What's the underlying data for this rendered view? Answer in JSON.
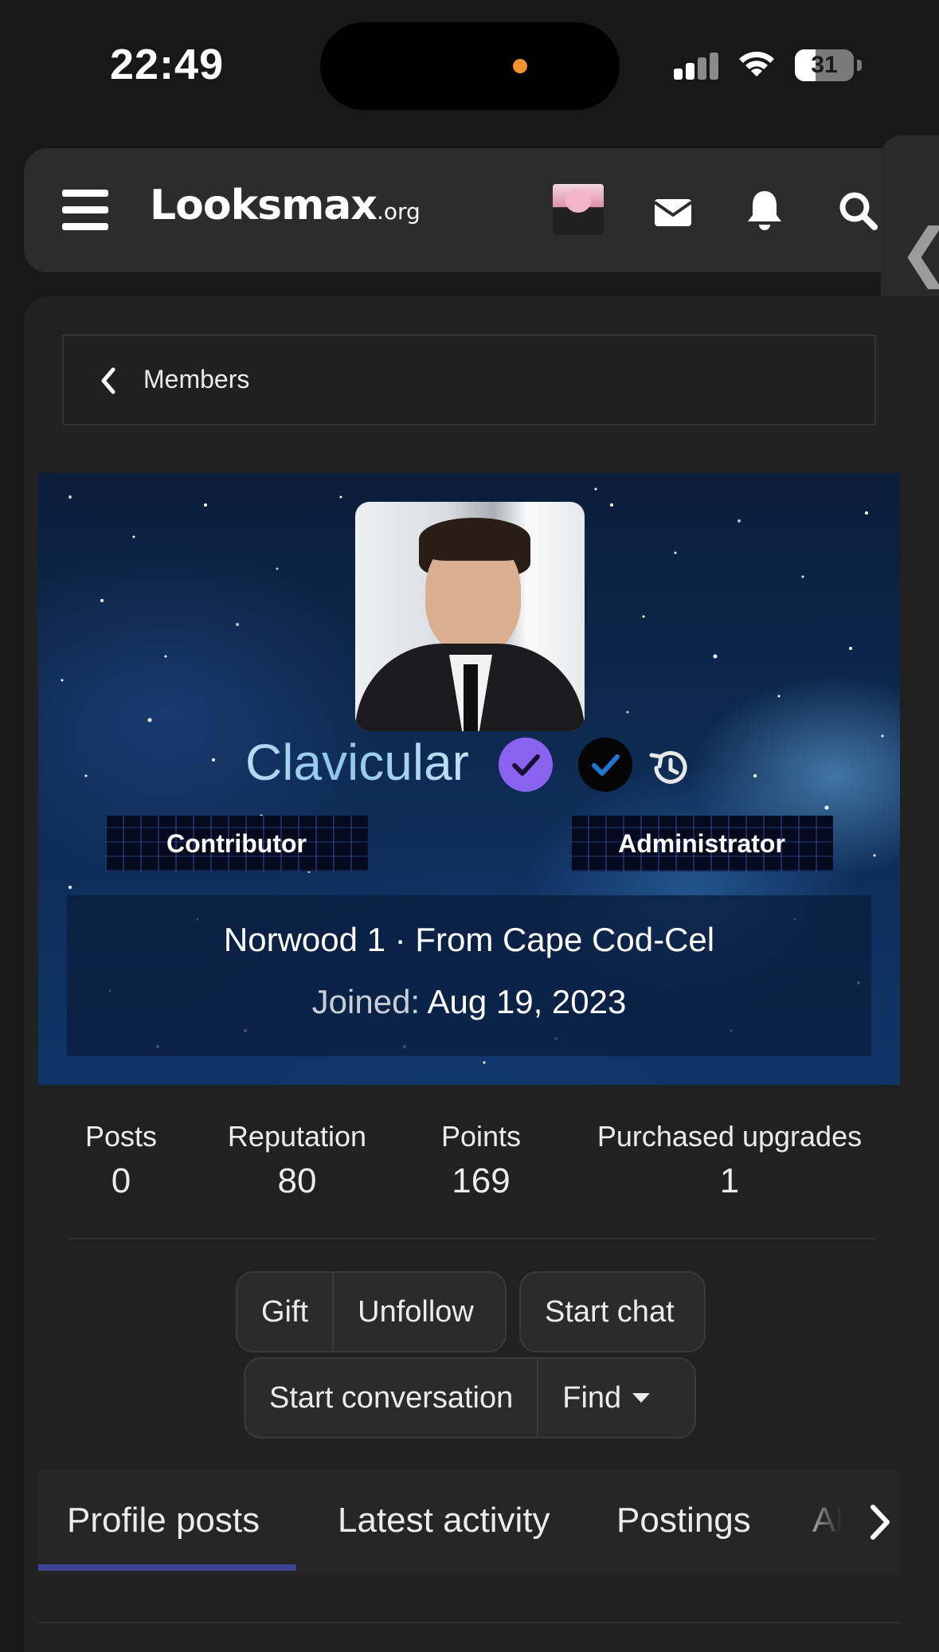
{
  "status_bar": {
    "time": "22:49",
    "battery": "31"
  },
  "header": {
    "logo_main": "Looksmax",
    "logo_tld": ".org",
    "icons": [
      "menu-icon",
      "avatar",
      "mail-icon",
      "bell-icon",
      "search-icon"
    ]
  },
  "breadcrumb": {
    "label": "Members"
  },
  "profile": {
    "username": "Clavicular",
    "roles": [
      "Contributor",
      "Administrator"
    ],
    "info_line": "Norwood 1 · From Cape Cod-Cel",
    "joined_label": "Joined:",
    "joined_date": "Aug 19, 2023",
    "badge_colors": {
      "verified": "#8a63f0",
      "checked": "#050505"
    }
  },
  "stats": [
    {
      "label": "Posts",
      "value": "0"
    },
    {
      "label": "Reputation",
      "value": "80"
    },
    {
      "label": "Points",
      "value": "169"
    },
    {
      "label": "Purchased upgrades",
      "value": "1"
    }
  ],
  "actions": {
    "gift": "Gift",
    "unfollow": "Unfollow",
    "start_chat": "Start chat",
    "start_conversation": "Start conversation",
    "find": "Find"
  },
  "tabs": [
    {
      "label": "Profile posts",
      "active": true
    },
    {
      "label": "Latest activity",
      "active": false
    },
    {
      "label": "Postings",
      "active": false
    },
    {
      "label": "Ab",
      "active": false
    }
  ],
  "colors": {
    "accent_tab": "#3b4497",
    "background": "#181818"
  }
}
